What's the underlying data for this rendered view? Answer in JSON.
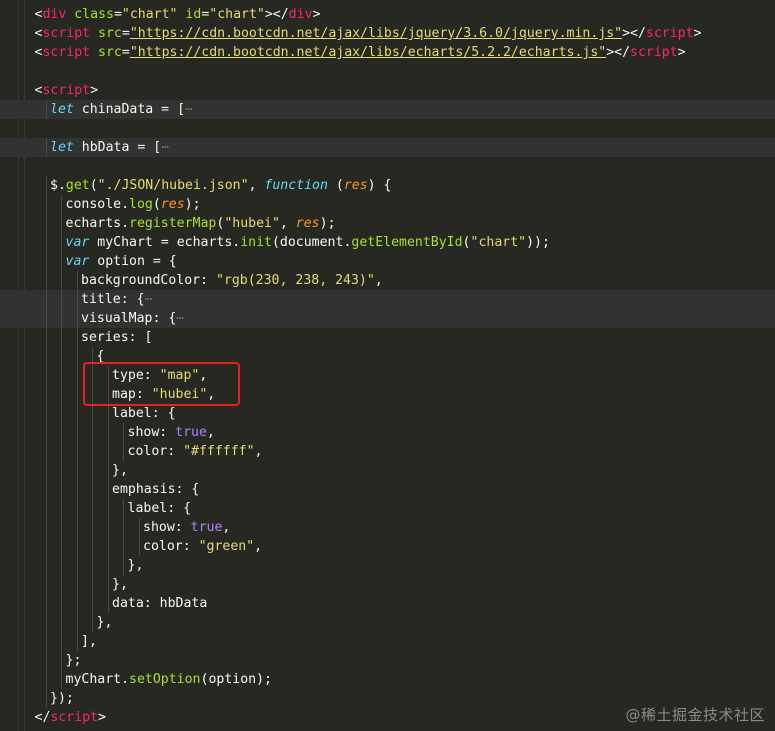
{
  "theme": {
    "background": "#272822",
    "text": "#f8f8f2",
    "tag": "#f92672",
    "attr": "#a6e22e",
    "string": "#e6db74",
    "keyword": "#66d9ef",
    "param": "#fd971f",
    "function": "#a6e22e",
    "boolean": "#ae81ff",
    "fold": "#75715e",
    "highlight_box": "#e02424"
  },
  "code_lines": [
    {
      "indent": 1,
      "highlighted": false,
      "tokens": [
        [
          "<",
          "p"
        ],
        [
          "div",
          "t"
        ],
        [
          " ",
          "p"
        ],
        [
          "class",
          "a"
        ],
        [
          "=",
          "p"
        ],
        [
          "\"chart\"",
          "s"
        ],
        [
          " ",
          "p"
        ],
        [
          "id",
          "a"
        ],
        [
          "=",
          "p"
        ],
        [
          "\"chart\"",
          "s"
        ],
        [
          "></",
          "p"
        ],
        [
          "div",
          "t"
        ],
        [
          ">",
          "p"
        ]
      ]
    },
    {
      "indent": 1,
      "highlighted": false,
      "tokens": [
        [
          "<",
          "p"
        ],
        [
          "script",
          "t"
        ],
        [
          " ",
          "p"
        ],
        [
          "src",
          "a"
        ],
        [
          "=",
          "p"
        ],
        [
          "\"https://cdn.bootcdn.net/ajax/libs/jquery/3.6.0/jquery.min.js\"",
          "u"
        ],
        [
          "></",
          "p"
        ],
        [
          "script",
          "t"
        ],
        [
          ">",
          "p"
        ]
      ]
    },
    {
      "indent": 1,
      "highlighted": false,
      "tokens": [
        [
          "<",
          "p"
        ],
        [
          "script",
          "t"
        ],
        [
          " ",
          "p"
        ],
        [
          "src",
          "a"
        ],
        [
          "=",
          "p"
        ],
        [
          "\"https://cdn.bootcdn.net/ajax/libs/echarts/5.2.2/echarts.js\"",
          "u"
        ],
        [
          "></",
          "p"
        ],
        [
          "script",
          "t"
        ],
        [
          ">",
          "p"
        ]
      ]
    },
    {
      "indent": 0,
      "highlighted": false,
      "tokens": []
    },
    {
      "indent": 1,
      "highlighted": false,
      "tokens": [
        [
          "<",
          "p"
        ],
        [
          "script",
          "t"
        ],
        [
          ">",
          "p"
        ]
      ]
    },
    {
      "indent": 2,
      "highlighted": true,
      "tokens": [
        [
          "let",
          "k"
        ],
        [
          " chinaData ",
          "p"
        ],
        [
          "=",
          "o"
        ],
        [
          " [",
          "p"
        ],
        [
          "⋯",
          "f"
        ]
      ]
    },
    {
      "indent": 0,
      "highlighted": false,
      "tokens": []
    },
    {
      "indent": 2,
      "highlighted": true,
      "tokens": [
        [
          "let",
          "k"
        ],
        [
          " hbData ",
          "p"
        ],
        [
          "=",
          "o"
        ],
        [
          " [",
          "p"
        ],
        [
          "⋯",
          "f"
        ]
      ]
    },
    {
      "indent": 0,
      "highlighted": false,
      "tokens": []
    },
    {
      "indent": 2,
      "highlighted": false,
      "tokens": [
        [
          "$.",
          "p"
        ],
        [
          "get",
          "n"
        ],
        [
          "(",
          "p"
        ],
        [
          "\"./JSON/hubei.json\"",
          "s"
        ],
        [
          ", ",
          "p"
        ],
        [
          "function",
          "k"
        ],
        [
          " (",
          "p"
        ],
        [
          "res",
          "r"
        ],
        [
          ") {",
          "p"
        ]
      ]
    },
    {
      "indent": 3,
      "highlighted": false,
      "tokens": [
        [
          "console.",
          "p"
        ],
        [
          "log",
          "n"
        ],
        [
          "(",
          "p"
        ],
        [
          "res",
          "r"
        ],
        [
          ");",
          "p"
        ]
      ]
    },
    {
      "indent": 3,
      "highlighted": false,
      "tokens": [
        [
          "echarts.",
          "p"
        ],
        [
          "registerMap",
          "n"
        ],
        [
          "(",
          "p"
        ],
        [
          "\"hubei\"",
          "s"
        ],
        [
          ", ",
          "p"
        ],
        [
          "res",
          "r"
        ],
        [
          ");",
          "p"
        ]
      ]
    },
    {
      "indent": 3,
      "highlighted": false,
      "tokens": [
        [
          "var",
          "k"
        ],
        [
          " myChart ",
          "p"
        ],
        [
          "=",
          "o"
        ],
        [
          " echarts.",
          "p"
        ],
        [
          "init",
          "n"
        ],
        [
          "(document.",
          "p"
        ],
        [
          "getElementById",
          "n"
        ],
        [
          "(",
          "p"
        ],
        [
          "\"chart\"",
          "s"
        ],
        [
          "));",
          "p"
        ]
      ]
    },
    {
      "indent": 3,
      "highlighted": false,
      "tokens": [
        [
          "var",
          "k"
        ],
        [
          " option ",
          "p"
        ],
        [
          "=",
          "o"
        ],
        [
          " {",
          "p"
        ]
      ]
    },
    {
      "indent": 4,
      "highlighted": false,
      "tokens": [
        [
          "backgroundColor: ",
          "p"
        ],
        [
          "\"rgb(230, 238, 243)\"",
          "s"
        ],
        [
          ",",
          "p"
        ]
      ]
    },
    {
      "indent": 4,
      "highlighted": true,
      "tokens": [
        [
          "title: {",
          "p"
        ],
        [
          "⋯",
          "f"
        ]
      ]
    },
    {
      "indent": 4,
      "highlighted": true,
      "tokens": [
        [
          "visualMap: {",
          "p"
        ],
        [
          "⋯",
          "f"
        ]
      ]
    },
    {
      "indent": 4,
      "highlighted": false,
      "tokens": [
        [
          "series: [",
          "p"
        ]
      ]
    },
    {
      "indent": 5,
      "highlighted": false,
      "tokens": [
        [
          "{",
          "p"
        ]
      ]
    },
    {
      "indent": 6,
      "highlighted": false,
      "tokens": [
        [
          "type: ",
          "p"
        ],
        [
          "\"map\"",
          "s"
        ],
        [
          ",",
          "p"
        ]
      ]
    },
    {
      "indent": 6,
      "highlighted": false,
      "tokens": [
        [
          "map: ",
          "p"
        ],
        [
          "\"hubei\"",
          "s"
        ],
        [
          ",",
          "p"
        ]
      ]
    },
    {
      "indent": 6,
      "highlighted": false,
      "tokens": [
        [
          "label: {",
          "p"
        ]
      ]
    },
    {
      "indent": 7,
      "highlighted": false,
      "tokens": [
        [
          "show: ",
          "p"
        ],
        [
          "true",
          "b"
        ],
        [
          ",",
          "p"
        ]
      ]
    },
    {
      "indent": 7,
      "highlighted": false,
      "tokens": [
        [
          "color: ",
          "p"
        ],
        [
          "\"#ffffff\"",
          "s"
        ],
        [
          ",",
          "p"
        ]
      ]
    },
    {
      "indent": 6,
      "highlighted": false,
      "tokens": [
        [
          "},",
          "p"
        ]
      ]
    },
    {
      "indent": 6,
      "highlighted": false,
      "tokens": [
        [
          "emphasis: {",
          "p"
        ]
      ]
    },
    {
      "indent": 7,
      "highlighted": false,
      "tokens": [
        [
          "label: {",
          "p"
        ]
      ]
    },
    {
      "indent": 8,
      "highlighted": false,
      "tokens": [
        [
          "show: ",
          "p"
        ],
        [
          "true",
          "b"
        ],
        [
          ",",
          "p"
        ]
      ]
    },
    {
      "indent": 8,
      "highlighted": false,
      "tokens": [
        [
          "color: ",
          "p"
        ],
        [
          "\"green\"",
          "s"
        ],
        [
          ",",
          "p"
        ]
      ]
    },
    {
      "indent": 7,
      "highlighted": false,
      "tokens": [
        [
          "},",
          "p"
        ]
      ]
    },
    {
      "indent": 6,
      "highlighted": false,
      "tokens": [
        [
          "},",
          "p"
        ]
      ]
    },
    {
      "indent": 6,
      "highlighted": false,
      "tokens": [
        [
          "data: hbData",
          "p"
        ]
      ]
    },
    {
      "indent": 5,
      "highlighted": false,
      "tokens": [
        [
          "},",
          "p"
        ]
      ]
    },
    {
      "indent": 4,
      "highlighted": false,
      "tokens": [
        [
          "],",
          "p"
        ]
      ]
    },
    {
      "indent": 3,
      "highlighted": false,
      "tokens": [
        [
          "};",
          "p"
        ]
      ]
    },
    {
      "indent": 3,
      "highlighted": false,
      "tokens": [
        [
          "myChart.",
          "p"
        ],
        [
          "setOption",
          "n"
        ],
        [
          "(option);",
          "p"
        ]
      ]
    },
    {
      "indent": 2,
      "highlighted": false,
      "tokens": [
        [
          "});",
          "p"
        ]
      ]
    },
    {
      "indent": 1,
      "highlighted": false,
      "tokens": [
        [
          "</",
          "p"
        ],
        [
          "script",
          "t"
        ],
        [
          ">",
          "p"
        ]
      ]
    }
  ],
  "watermark": "@稀土掘金技术社区"
}
